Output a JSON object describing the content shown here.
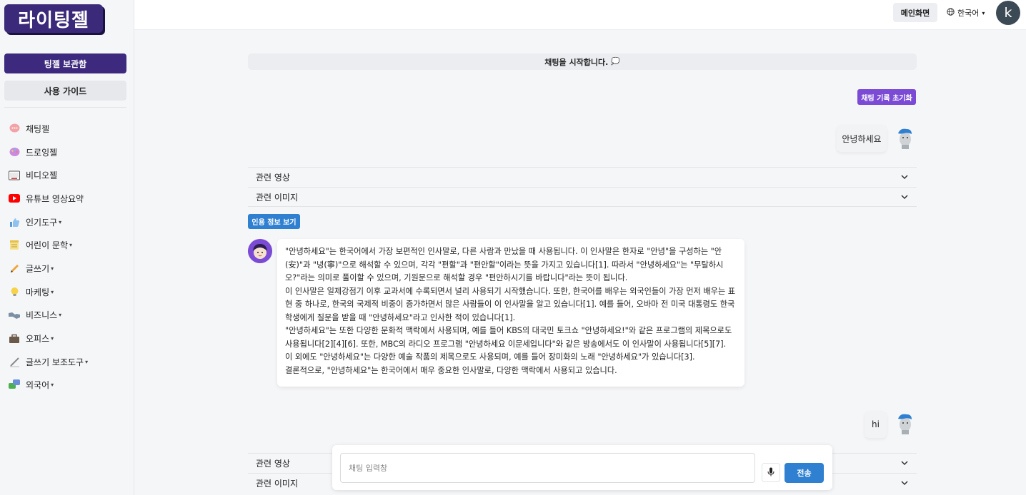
{
  "app": {
    "logo_text": "라이팅젤"
  },
  "sidebar": {
    "archive_button": "팅젤 보관함",
    "guide_button": "사용 가이드",
    "items": [
      {
        "label": "채팅젤",
        "icon": "chat-bubble-icon",
        "has_chevron": false
      },
      {
        "label": "드로잉젤",
        "icon": "palette-icon",
        "has_chevron": false
      },
      {
        "label": "비디오젤",
        "icon": "video-screen-icon",
        "has_chevron": false
      },
      {
        "label": "유튜브 영상요약",
        "icon": "youtube-icon",
        "has_chevron": false
      },
      {
        "label": "인기도구",
        "icon": "thumbs-up-icon",
        "has_chevron": true
      },
      {
        "label": "어린이 문학",
        "icon": "notepad-icon",
        "has_chevron": true
      },
      {
        "label": "글쓰기",
        "icon": "pencil-icon",
        "has_chevron": true
      },
      {
        "label": "마케팅",
        "icon": "lightbulb-icon",
        "has_chevron": true
      },
      {
        "label": "비즈니스",
        "icon": "handshake-icon",
        "has_chevron": true
      },
      {
        "label": "오피스",
        "icon": "briefcase-icon",
        "has_chevron": true
      },
      {
        "label": "글쓰기 보조도구",
        "icon": "pen-icon",
        "has_chevron": true
      },
      {
        "label": "외국어",
        "icon": "speech-bubbles-icon",
        "has_chevron": true
      }
    ]
  },
  "topbar": {
    "main_button": "메인화면",
    "language": "한국어",
    "avatar_letter": "k"
  },
  "chat": {
    "start_banner": "채팅을 시작합니다.",
    "start_emoji": "💭",
    "reset_button": "채팅 기록 초기화",
    "messages": [
      {
        "role": "user",
        "text": "안녕하세요"
      },
      {
        "role": "user",
        "text": "hi"
      }
    ],
    "related_video": "관련 영상",
    "related_image": "관련 이미지",
    "cite_button": "인용 정보 보기",
    "bot_reply": {
      "paragraphs": [
        "\"안녕하세요\"는 한국어에서 가장 보편적인 인사말로, 다른 사람과 만났을 때 사용됩니다. 이 인사말은 한자로 \"안녕\"을 구성하는 \"안(安)\"과 \"녕(寧)\"으로 해석할 수 있으며, 각각 \"편할\"과 \"편안할\"이라는 뜻을 가지고 있습니다[1]. 따라서 \"안녕하세요\"는 \"무탈하시오?\"라는 의미로 풀이할 수 있으며, 기원문으로 해석할 경우 \"편안하시기를 바랍니다\"라는 뜻이 됩니다.",
        "이 인사말은 일제강점기 이후 교과서에 수록되면서 널리 사용되기 시작했습니다. 또한, 한국어를 배우는 외국인들이 가장 먼저 배우는 표현 중 하나로, 한국의 국제적 비중이 증가하면서 많은 사람들이 이 인사말을 알고 있습니다[1]. 예를 들어, 오바마 전 미국 대통령도 한국 학생에게 질문을 받을 때 \"안녕하세요\"라고 인사한 적이 있습니다[1].",
        "\"안녕하세요\"는 또한 다양한 문화적 맥락에서 사용되며, 예를 들어 KBS의 대국민 토크쇼 \"안녕하세요!\"와 같은 프로그램의 제목으로도 사용됩니다[2][4][6]. 또한, MBC의 라디오 프로그램 \"안녕하세요 이문세입니다\"와 같은 방송에서도 이 인사말이 사용됩니다[5][7].",
        "이 외에도 \"안녕하세요\"는 다양한 예술 작품의 제목으로도 사용되며, 예를 들어 장미화의 노래 \"안녕하세요\"가 있습니다[3].",
        "결론적으로, \"안녕하세요\"는 한국어에서 매우 중요한 인사말로, 다양한 맥락에서 사용되고 있습니다."
      ]
    }
  },
  "input": {
    "placeholder": "채팅 입력창",
    "value": "",
    "send_button": "전송"
  },
  "colors": {
    "brand_purple": "#3d2a7e",
    "accent_purple": "#7b4bd6",
    "accent_blue": "#2f80d1"
  }
}
